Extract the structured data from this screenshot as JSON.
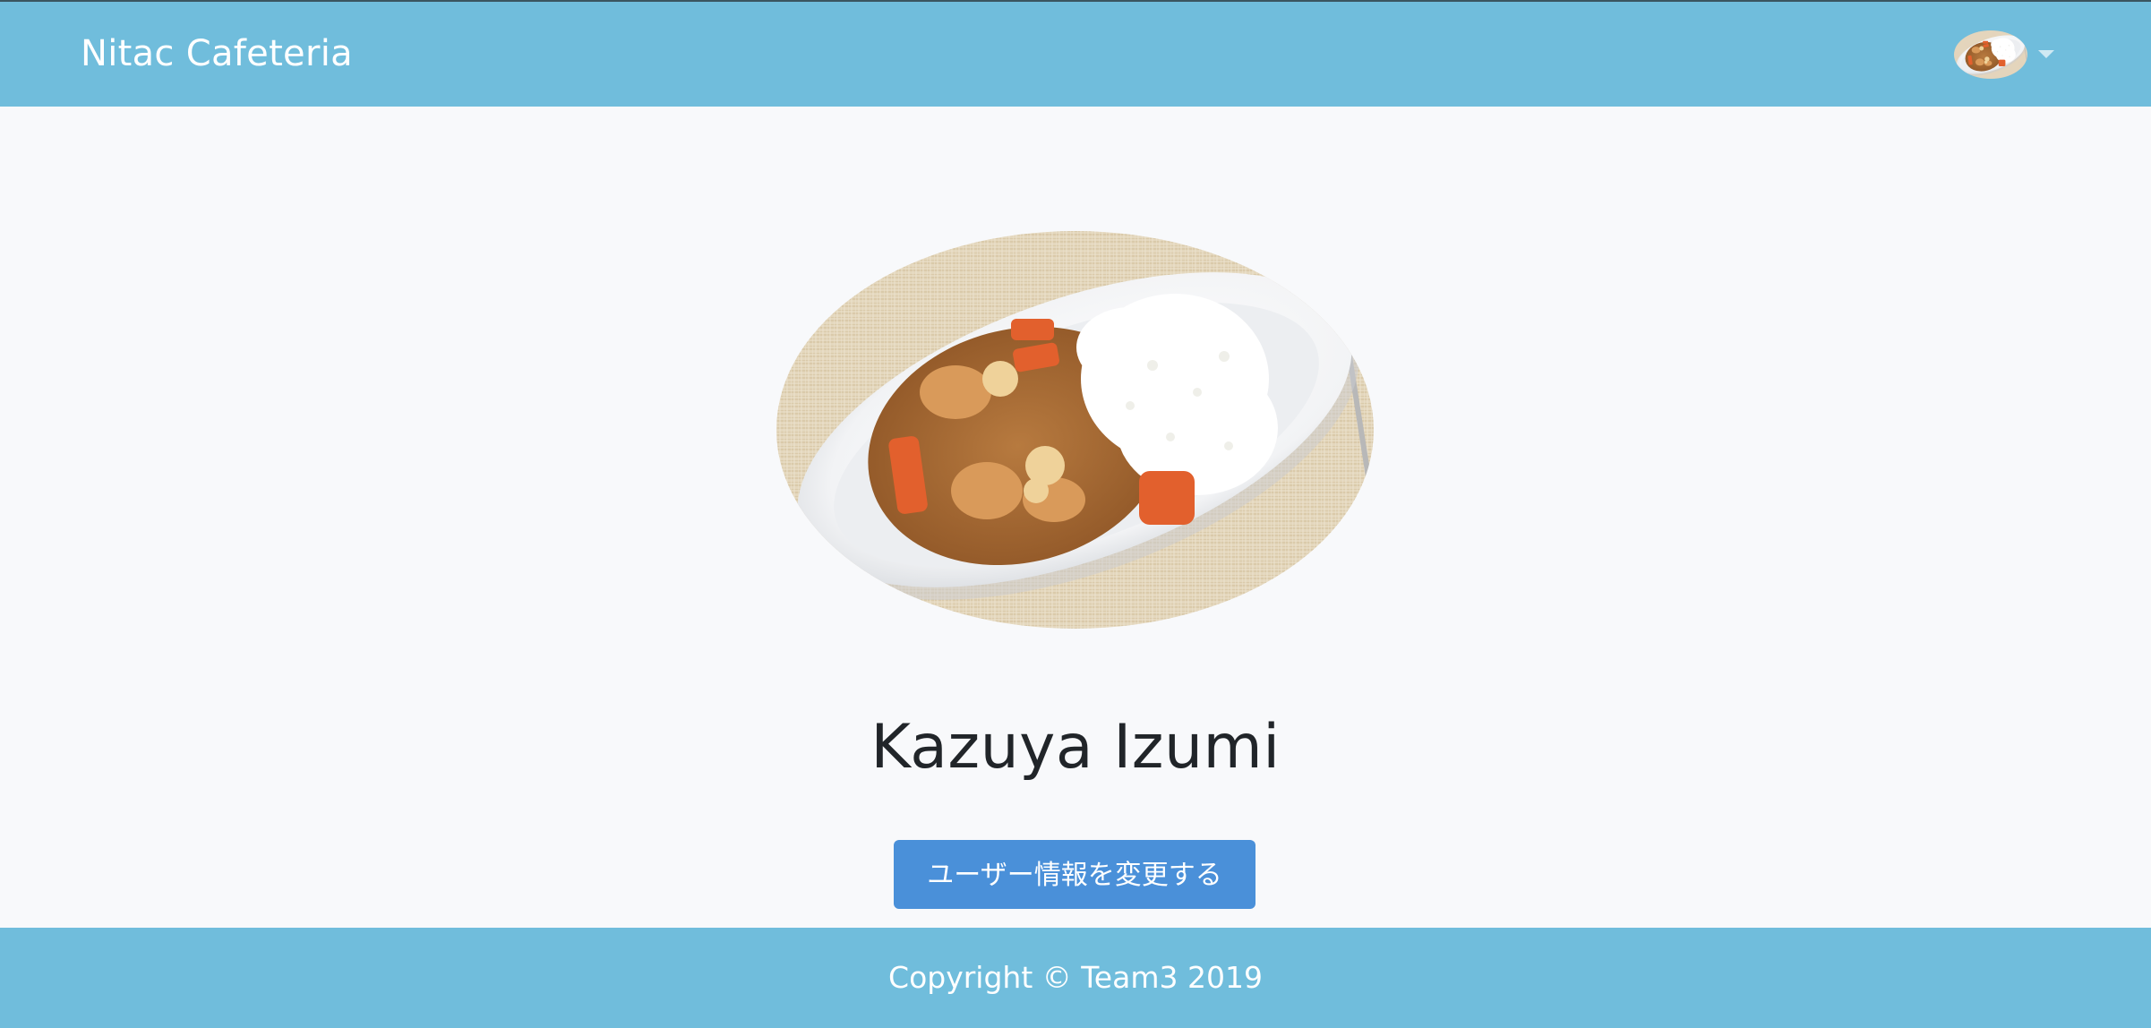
{
  "app": {
    "brand": "Nitac Cafeteria"
  },
  "header": {
    "user_menu_icon": "chevron-down-icon",
    "avatar_image": "curry-rice-photo"
  },
  "profile": {
    "photo": "curry-rice-photo",
    "name": "Kazuya Izumi",
    "edit_button_label": "ユーザー情報を変更する"
  },
  "footer": {
    "copyright": "Copyright © Team3 2019"
  },
  "colors": {
    "navbar_bg": "#70bddc",
    "page_bg": "#f8f9fb",
    "button_bg": "#4a90d9",
    "text_dark": "#212529"
  }
}
